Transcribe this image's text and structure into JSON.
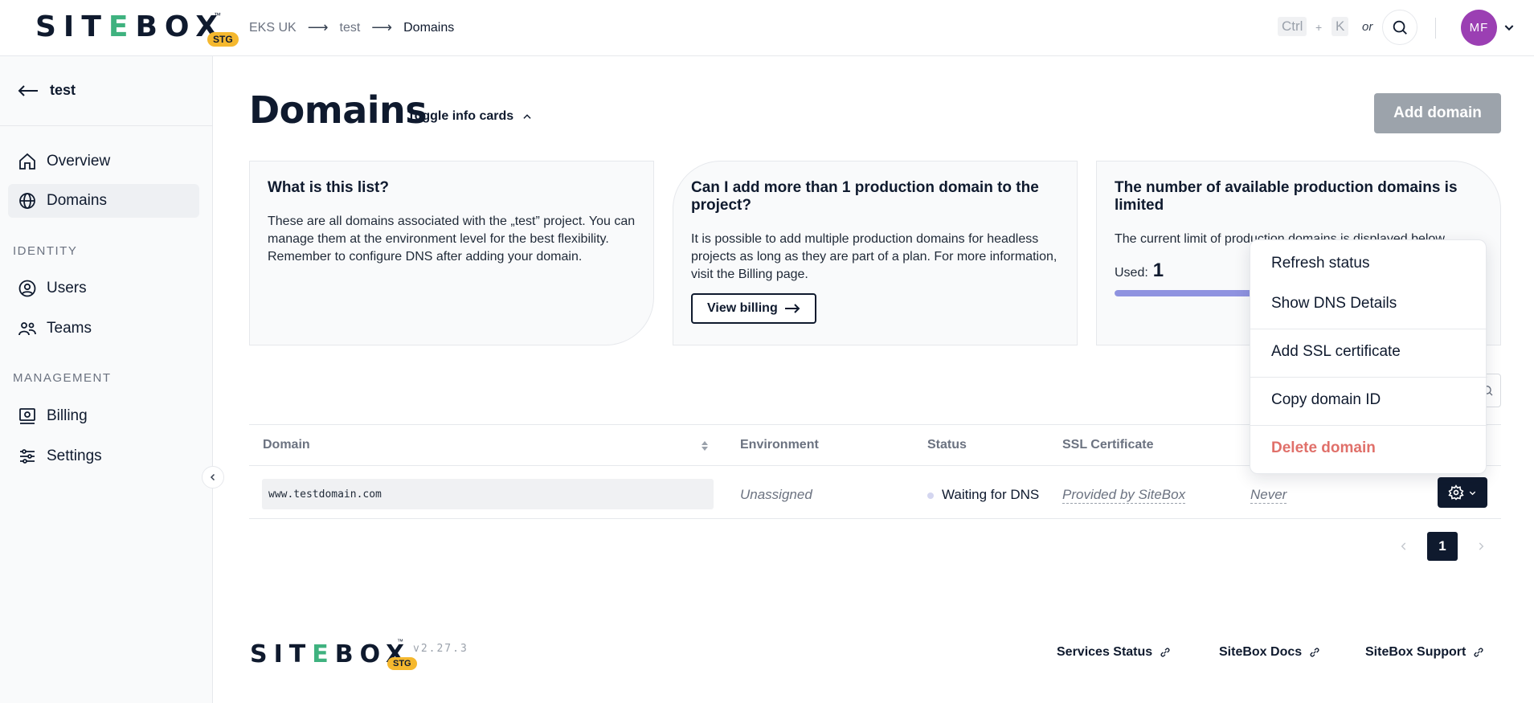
{
  "header": {
    "logo": {
      "prefix": "SIT",
      "mark": "E",
      "suffix": "BOX",
      "tm": "™",
      "badge": "STG"
    },
    "breadcrumb": [
      "EKS UK",
      "test",
      "Domains"
    ],
    "shortcut": {
      "key1": "Ctrl",
      "plus": "+",
      "key2": "K",
      "or": "or"
    },
    "avatar_initials": "MF"
  },
  "sidebar": {
    "back_label": "test",
    "items": [
      {
        "label": "Overview",
        "icon": "home-icon"
      },
      {
        "label": "Domains",
        "icon": "globe-icon",
        "active": true
      }
    ],
    "sections": [
      {
        "title": "IDENTITY",
        "items": [
          {
            "label": "Users",
            "icon": "user-icon"
          },
          {
            "label": "Teams",
            "icon": "team-icon"
          }
        ]
      },
      {
        "title": "MANAGEMENT",
        "items": [
          {
            "label": "Billing",
            "icon": "billing-icon"
          },
          {
            "label": "Settings",
            "icon": "settings-icon"
          }
        ]
      }
    ]
  },
  "main": {
    "title": "Domains",
    "toggle_info_label": "Toggle info cards",
    "add_domain_label": "Add domain",
    "cards": [
      {
        "title": "What is this list?",
        "body": "These are all domains associated with the „test” project. You can manage them at the environment level for the best flexibility. Remember to configure DNS after adding your domain."
      },
      {
        "title": "Can I add more than 1 production domain to the project?",
        "body": "It is possible to add multiple production domains for headless projects as long as they are part of a plan. For more information, visit the Billing page.",
        "button": "View billing"
      },
      {
        "title": "The number of available production domains is limited",
        "body": "The current limit of production domains is displayed below.",
        "used_label": "Used:",
        "used_value": "1",
        "usage_fraction": 1.0
      }
    ],
    "table": {
      "columns": [
        "Domain",
        "Environment",
        "Status",
        "SSL Certificate"
      ],
      "rows": [
        {
          "domain": "www.testdomain.com",
          "environment": "Unassigned",
          "status": "Waiting for DNS",
          "ssl": "Provided by SiteBox",
          "last": "Never"
        }
      ]
    },
    "pagination": {
      "current": "1"
    }
  },
  "menu": {
    "items": [
      "Refresh status",
      "Show DNS Details",
      "Add SSL certificate",
      "Copy domain ID",
      "Delete domain"
    ]
  },
  "footer": {
    "version": "v2.27.3",
    "links": [
      "Services Status",
      "SiteBox Docs",
      "SiteBox Support"
    ]
  },
  "colors": {
    "brand_dark": "#0f1a2e",
    "brand_green": "#3fb27f",
    "stg_badge": "#f5b82e",
    "avatar": "#9b3fb3",
    "danger": "#e0706a",
    "progress": "#8f93e0"
  }
}
